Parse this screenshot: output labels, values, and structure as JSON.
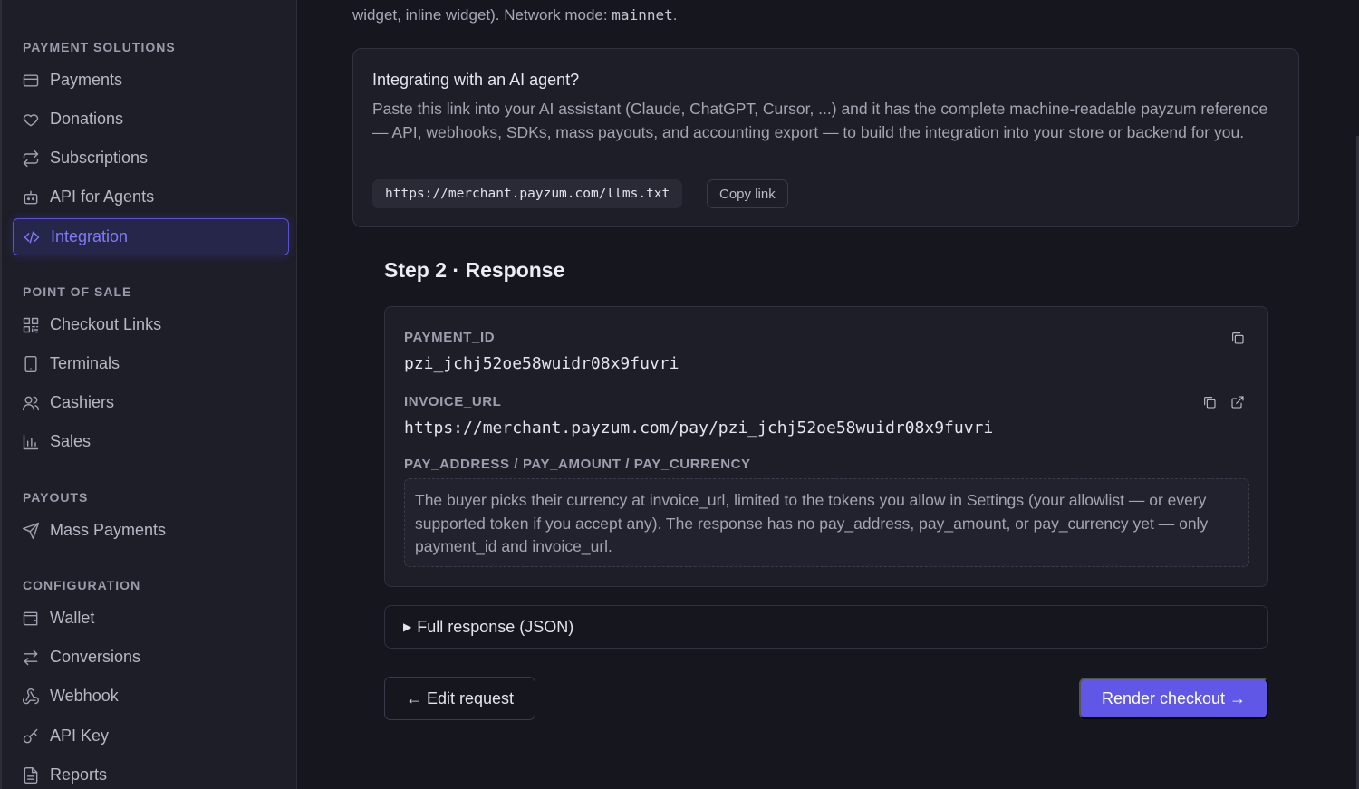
{
  "sidebar": {
    "sections": [
      {
        "title": "PAYMENT SOLUTIONS"
      },
      {
        "title": "POINT OF SALE"
      },
      {
        "title": "PAYOUTS"
      },
      {
        "title": "CONFIGURATION"
      }
    ],
    "items": [
      {
        "label": "Payments",
        "icon": "card-icon"
      },
      {
        "label": "Donations",
        "icon": "heart-icon"
      },
      {
        "label": "Subscriptions",
        "icon": "repeat-icon"
      },
      {
        "label": "API for Agents",
        "icon": "bot-icon"
      },
      {
        "label": "Integration",
        "icon": "code-icon",
        "active": true
      },
      {
        "label": "Checkout Links",
        "icon": "qr-icon"
      },
      {
        "label": "Terminals",
        "icon": "tablet-icon"
      },
      {
        "label": "Cashiers",
        "icon": "users-icon"
      },
      {
        "label": "Sales",
        "icon": "bar-chart-icon"
      },
      {
        "label": "Mass Payments",
        "icon": "send-icon"
      },
      {
        "label": "Wallet",
        "icon": "wallet-icon"
      },
      {
        "label": "Conversions",
        "icon": "arrows-swap-icon"
      },
      {
        "label": "Webhook",
        "icon": "webhook-icon"
      },
      {
        "label": "API Key",
        "icon": "key-icon"
      },
      {
        "label": "Reports",
        "icon": "file-text-icon"
      }
    ]
  },
  "main": {
    "intro_text_pre": "widget, inline widget). Network mode: ",
    "intro_mode": "mainnet",
    "intro_text_post": ".",
    "ai_card": {
      "title": "Integrating with an AI agent?",
      "body": "Paste this link into your AI assistant (Claude, ChatGPT, Cursor, ...) and it has the complete machine-readable payzum reference — API, webhooks, SDKs, mass payouts, and accounting export — to build the integration into your store or backend for you.",
      "link": "https://merchant.payzum.com/llms.txt",
      "copy_label": "Copy link"
    },
    "step_title": "Step 2 · Response",
    "response": {
      "payment_id_label": "PAYMENT_ID",
      "payment_id_value": "pzi_jchj52oe58wuidr08x9fuvri",
      "invoice_url_label": "INVOICE_URL",
      "invoice_url_value": "https://merchant.payzum.com/pay/pzi_jchj52oe58wuidr08x9fuvri",
      "pay_fields_label": "PAY_ADDRESS / PAY_AMOUNT / PAY_CURRENCY",
      "pay_fields_note": "The buyer picks their currency at invoice_url, limited to the tokens you allow in Settings (your allowlist — or every supported token if you accept any). The response has no pay_address, pay_amount, or pay_currency yet — only payment_id and invoice_url."
    },
    "json_toggle_label": "Full response (JSON)",
    "edit_button": "← Edit request",
    "render_button": "Render checkout →"
  },
  "colors": {
    "accent": "#6157e6",
    "active_text": "#7f7bf5",
    "background": "#16161f",
    "sidebar": "#1e1e29"
  }
}
